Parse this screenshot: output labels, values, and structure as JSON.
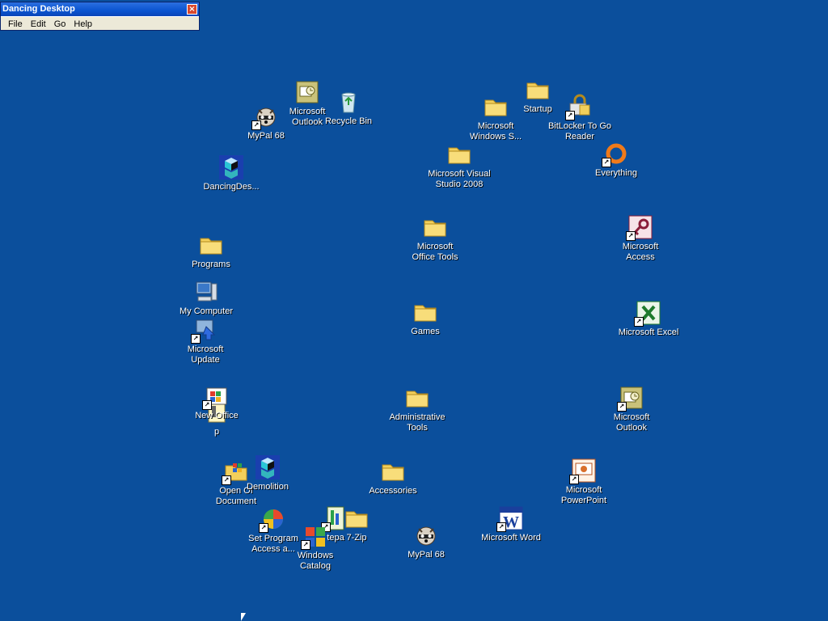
{
  "window": {
    "title": "Dancing Desktop",
    "close_glyph": "×",
    "menus": [
      "File",
      "Edit",
      "Go",
      "Help"
    ]
  },
  "icons": [
    {
      "id": "mypal-68-top",
      "label": "MyPal 68",
      "icon": "raccoon-icon",
      "shortcut": true
    },
    {
      "id": "microsoft-outlook-top",
      "label": "Microsoft\nOutlook",
      "icon": "outlook-icon",
      "shortcut": false
    },
    {
      "id": "recycle-bin",
      "label": "Recycle Bin",
      "icon": "recycle-bin-icon",
      "shortcut": false
    },
    {
      "id": "dancingdes",
      "label": "DancingDes...",
      "icon": "dancing-desktop-icon",
      "shortcut": false
    },
    {
      "id": "programs",
      "label": "Programs",
      "icon": "folder-icon",
      "shortcut": false
    },
    {
      "id": "my-computer",
      "label": "My Computer",
      "icon": "computer-icon",
      "shortcut": false
    },
    {
      "id": "microsoft-update",
      "label": "Microsoft\nUpdate",
      "icon": "update-icon",
      "shortcut": true
    },
    {
      "id": "p-item",
      "label": "p",
      "icon": "small-app-icon",
      "shortcut": false
    },
    {
      "id": "new-office",
      "label": "New Office",
      "icon": "new-office-icon",
      "shortcut": true
    },
    {
      "id": "open-office-document",
      "label": "Open Of\nDocument",
      "icon": "open-office-icon",
      "shortcut": true
    },
    {
      "id": "demolition",
      "label": "Demolition",
      "icon": "dancing-desktop-icon",
      "shortcut": false
    },
    {
      "id": "set-program-access",
      "label": "Set Program\nAccess a...",
      "icon": "set-program-icon",
      "shortcut": true
    },
    {
      "id": "tepa",
      "label": "tepa",
      "icon": "app-icon",
      "shortcut": true
    },
    {
      "id": "seven-zip",
      "label": "7-Zip",
      "icon": "folder-icon",
      "shortcut": false
    },
    {
      "id": "windows-catalog",
      "label": "Windows\nCatalog",
      "icon": "catalog-icon",
      "shortcut": true
    },
    {
      "id": "accessories",
      "label": "Accessories",
      "icon": "folder-icon",
      "shortcut": false
    },
    {
      "id": "mypal-68-bottom",
      "label": "MyPal 68",
      "icon": "raccoon-icon",
      "shortcut": false
    },
    {
      "id": "microsoft-word",
      "label": "Microsoft Word",
      "icon": "word-icon",
      "shortcut": true
    },
    {
      "id": "microsoft-powerpoint",
      "label": "Microsoft\nPowerPoint",
      "icon": "powerpoint-icon",
      "shortcut": true
    },
    {
      "id": "microsoft-outlook-right",
      "label": "Microsoft\nOutlook",
      "icon": "outlook-icon",
      "shortcut": true
    },
    {
      "id": "microsoft-excel",
      "label": "Microsoft Excel",
      "icon": "excel-icon",
      "shortcut": true
    },
    {
      "id": "microsoft-access",
      "label": "Microsoft\nAccess",
      "icon": "access-icon",
      "shortcut": true
    },
    {
      "id": "everything",
      "label": "Everything",
      "icon": "everything-icon",
      "shortcut": true
    },
    {
      "id": "bitlocker",
      "label": "BitLocker To Go\nReader",
      "icon": "bitlocker-icon",
      "shortcut": true
    },
    {
      "id": "startup",
      "label": "Startup",
      "icon": "folder-icon",
      "shortcut": false
    },
    {
      "id": "microsoft-windows-s",
      "label": "Microsoft\nWindows S...",
      "icon": "folder-icon",
      "shortcut": false
    },
    {
      "id": "microsoft-visual-studio",
      "label": "Microsoft Visual\nStudio 2008",
      "icon": "folder-icon",
      "shortcut": false
    },
    {
      "id": "microsoft-office-tools",
      "label": "Microsoft\nOffice Tools",
      "icon": "folder-icon",
      "shortcut": false
    },
    {
      "id": "games",
      "label": "Games",
      "icon": "folder-icon",
      "shortcut": false
    },
    {
      "id": "administrative-tools",
      "label": "Administrative\nTools",
      "icon": "folder-icon",
      "shortcut": false
    }
  ]
}
